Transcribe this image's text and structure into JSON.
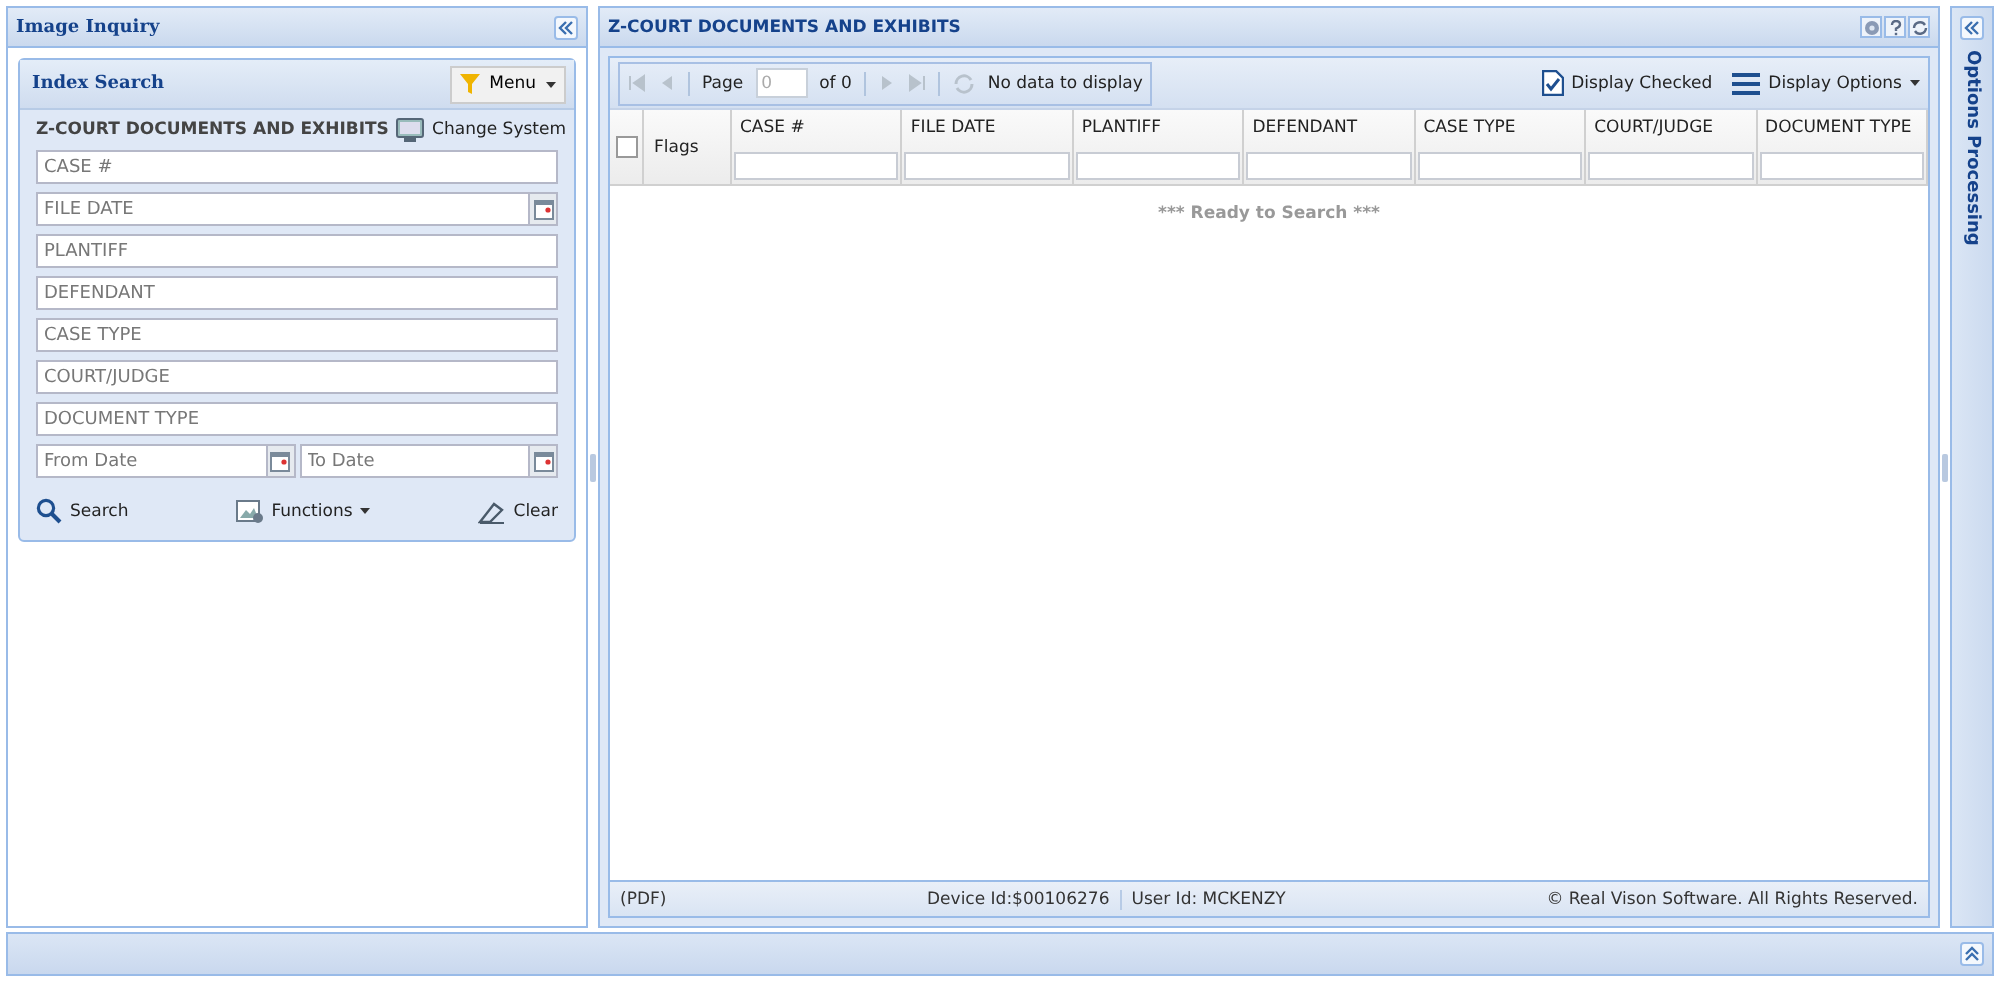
{
  "left_panel": {
    "title": "Image Inquiry",
    "search_panel": {
      "title": "Index Search",
      "menu_button": "Menu",
      "system_title": "Z-COURT DOCUMENTS AND EXHIBITS",
      "change_system": "Change System",
      "fields": [
        {
          "placeholder": "CASE #",
          "kind": "text"
        },
        {
          "placeholder": "FILE DATE",
          "kind": "date"
        },
        {
          "placeholder": "PLANTIFF",
          "kind": "text"
        },
        {
          "placeholder": "DEFENDANT",
          "kind": "text"
        },
        {
          "placeholder": "CASE TYPE",
          "kind": "text"
        },
        {
          "placeholder": "COURT/JUDGE",
          "kind": "text"
        },
        {
          "placeholder": "DOCUMENT TYPE",
          "kind": "text"
        }
      ],
      "date_range": [
        {
          "placeholder": "From Date"
        },
        {
          "placeholder": "To Date"
        }
      ],
      "buttons": {
        "search": "Search",
        "functions": "Functions",
        "clear": "Clear"
      }
    }
  },
  "main_panel": {
    "title": "Z-COURT DOCUMENTS AND EXHIBITS",
    "toolbar": {
      "page_label": "Page",
      "page_value": "0",
      "of_label": "of 0",
      "status": "No data to display",
      "display_checked": "Display Checked",
      "display_options": "Display Options"
    },
    "table": {
      "select_all_checked": false,
      "flags_column": "Flags",
      "columns": [
        "CASE #",
        "FILE DATE",
        "PLANTIFF",
        "DEFENDANT",
        "CASE TYPE",
        "COURT/JUDGE",
        "DOCUMENT TYPE"
      ],
      "message": "*** Ready to Search ***"
    },
    "status_bar": {
      "format": "(PDF)",
      "device": "Device Id:$00106276",
      "user": "User Id: MCKENZY",
      "copyright": "© Real Vison Software. All Rights Reserved."
    }
  },
  "right_panel": {
    "title": "Options Processing"
  }
}
